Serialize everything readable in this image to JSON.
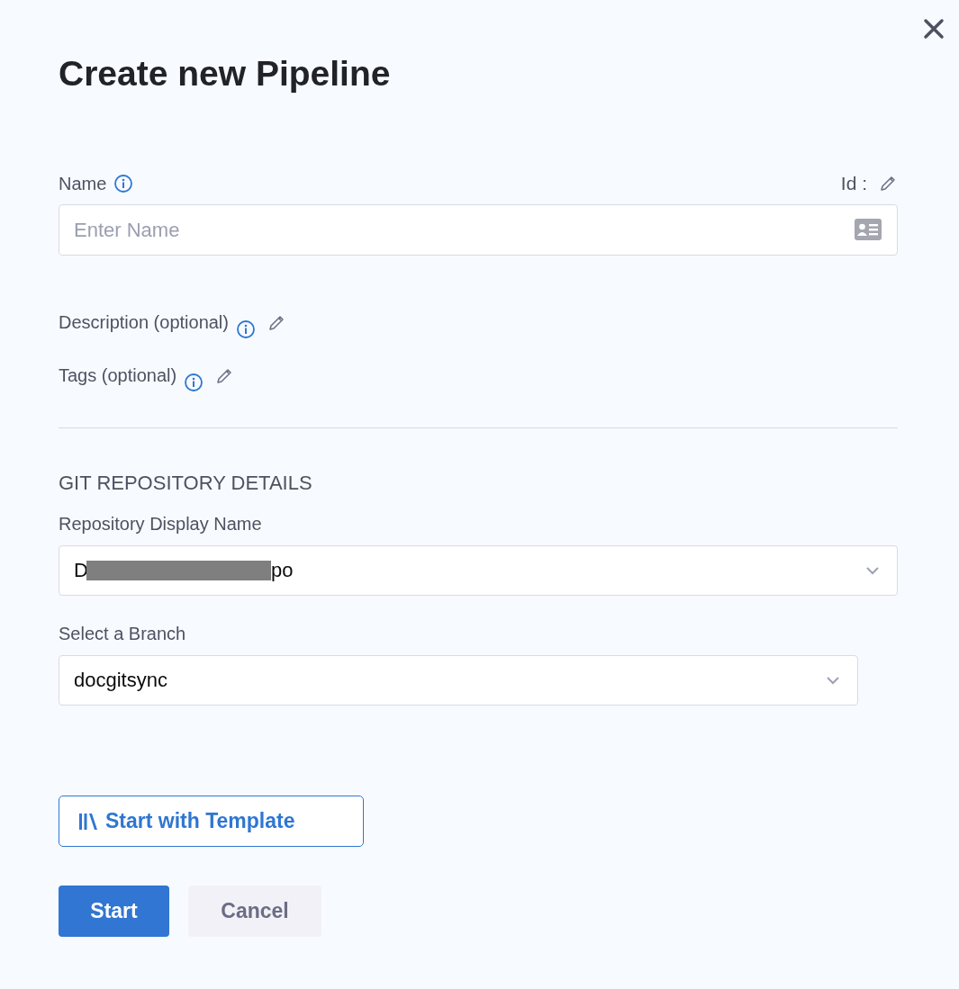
{
  "title": "Create new Pipeline",
  "name_field": {
    "label": "Name",
    "id_label": "Id :",
    "placeholder": "Enter Name"
  },
  "optional_fields": [
    {
      "label": "Description (optional)"
    },
    {
      "label": "Tags (optional)"
    }
  ],
  "git": {
    "heading": "GIT REPOSITORY DETAILS",
    "repository": {
      "label": "Repository Display Name",
      "value_start": "D",
      "value_end": "po"
    },
    "branch": {
      "label": "Select a Branch",
      "value": "docgitsync"
    }
  },
  "template_button": {
    "label": "Start with Template"
  },
  "buttons": [
    {
      "label": "Start",
      "kind": "primary"
    },
    {
      "label": "Cancel",
      "kind": "secondary"
    }
  ]
}
